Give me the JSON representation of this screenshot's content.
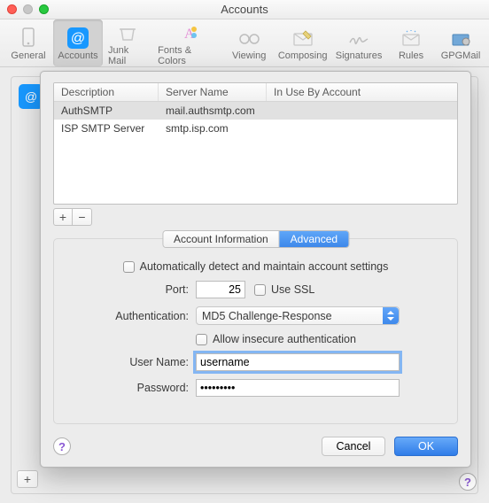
{
  "title": "Accounts",
  "toolbar": [
    {
      "id": "general",
      "label": "General"
    },
    {
      "id": "accounts",
      "label": "Accounts"
    },
    {
      "id": "junk",
      "label": "Junk Mail"
    },
    {
      "id": "fonts",
      "label": "Fonts & Colors"
    },
    {
      "id": "viewing",
      "label": "Viewing"
    },
    {
      "id": "composing",
      "label": "Composing"
    },
    {
      "id": "signatures",
      "label": "Signatures"
    },
    {
      "id": "rules",
      "label": "Rules"
    },
    {
      "id": "gpgmail",
      "label": "GPGMail"
    }
  ],
  "columns": {
    "description": "Description",
    "server": "Server Name",
    "inuse": "In Use By Account"
  },
  "servers": [
    {
      "description": "AuthSMTP",
      "server": "mail.authsmtp.com",
      "inuse": ""
    },
    {
      "description": "ISP SMTP Server",
      "server": "smtp.isp.com",
      "inuse": ""
    }
  ],
  "tabs": {
    "info": "Account Information",
    "advanced": "Advanced"
  },
  "form": {
    "auto_detect_label": "Automatically detect and maintain account settings",
    "port_label": "Port:",
    "port_value": "25",
    "use_ssl_label": "Use SSL",
    "auth_label": "Authentication:",
    "auth_value": "MD5 Challenge-Response",
    "allow_insecure_label": "Allow insecure authentication",
    "username_label": "User Name:",
    "username_value": "username",
    "password_label": "Password:",
    "password_value": "•••••••••"
  },
  "buttons": {
    "cancel": "Cancel",
    "ok": "OK",
    "plus": "+",
    "minus": "−",
    "help": "?"
  }
}
